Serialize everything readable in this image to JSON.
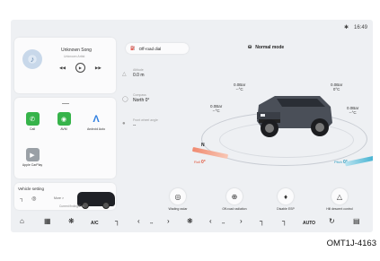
{
  "status_bar": {
    "time": "16:49",
    "icon": "bluetooth-icon"
  },
  "music": {
    "song": "Unknown Song",
    "artist": "Unknown Artist",
    "icon": "music-note-icon"
  },
  "apps": [
    {
      "label": "Call",
      "icon": "phone-icon",
      "color": "#36b34a"
    },
    {
      "label": "AVM",
      "icon": "camera-icon",
      "color": "#36b34a"
    },
    {
      "label": "Android Auto",
      "icon": "android-auto-icon",
      "color": "#2f7fe0"
    },
    {
      "label": "Apple CarPlay",
      "icon": "carplay-icon",
      "color": "#9aa0a6"
    }
  ],
  "vehicle_setting": {
    "title": "Vehicle setting",
    "more": "More >",
    "footer": "Current finding/Erm"
  },
  "offroad": {
    "button_label": "Off-road dial",
    "mode_label": "Normal mode",
    "altitude": {
      "label": "Altitude",
      "value": "0.0 m"
    },
    "compass": {
      "label": "Compass",
      "value": "North 0°"
    },
    "wheel_angle": {
      "label": "Front wheel angle",
      "value": "--"
    },
    "compass_letter": "N",
    "tires": [
      {
        "pressure": "0.0Bar",
        "temp": "--°C"
      },
      {
        "pressure": "0.0Bar",
        "temp": "0°C"
      },
      {
        "pressure": "0.0Bar",
        "temp": "--°C"
      },
      {
        "pressure": "0.0Bar",
        "temp": "--°C"
      }
    ],
    "roll": {
      "label": "Roll",
      "value": "0°"
    },
    "pitch": {
      "label": "Pitch",
      "value": "0°"
    }
  },
  "functions": [
    {
      "label": "Wading radar",
      "icon": "wading-radar-icon"
    },
    {
      "label": "Off-road radiation",
      "icon": "offroad-radiation-icon"
    },
    {
      "label": "Disable ESP",
      "icon": "esp-off-icon"
    },
    {
      "label": "Hill descent control",
      "icon": "hill-descent-icon"
    }
  ],
  "dock": {
    "ac_label": "A/C",
    "auto_label": "AUTO",
    "left_temp": "--",
    "right_temp": "--"
  },
  "caption": "OMT1J-4163"
}
